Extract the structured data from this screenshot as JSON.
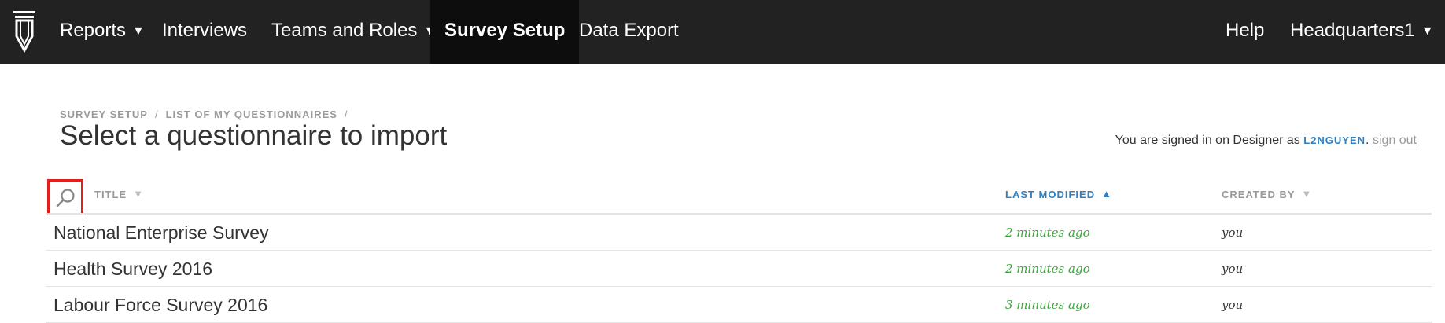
{
  "navbar": {
    "logo_icon": "pen-nib-logo-icon",
    "items": [
      {
        "label": "Reports",
        "dropdown": true
      },
      {
        "label": "Interviews",
        "dropdown": false
      },
      {
        "label": "Teams and Roles",
        "dropdown": true
      },
      {
        "label": "Survey Setup",
        "dropdown": false,
        "active": true
      },
      {
        "label": "Data Export",
        "dropdown": false
      }
    ],
    "right_items": [
      {
        "label": "Help",
        "dropdown": false
      },
      {
        "label": "Headquarters1",
        "dropdown": true
      }
    ],
    "caret": "▼"
  },
  "breadcrumb": {
    "items": [
      "Survey Setup",
      "List of my questionnaires"
    ],
    "separator": "/"
  },
  "page_title": "Select a questionnaire to import",
  "signin": {
    "prefix": "You are signed in on Designer as",
    "username": "L2NGUYEN",
    "punct": ".",
    "sign_out": "sign out"
  },
  "table": {
    "search_icon": "search-icon",
    "columns": {
      "title": "Title",
      "last_modified": "Last Modified",
      "created_by": "Created By"
    },
    "sort": {
      "column": "last_modified",
      "direction": "ascending"
    },
    "sort_icon_up": "▲",
    "sort_icon_down": "▼",
    "rows": [
      {
        "title": "National Enterprise Survey",
        "last_modified": "2 minutes ago",
        "created_by": "you"
      },
      {
        "title": "Health Survey 2016",
        "last_modified": "2 minutes ago",
        "created_by": "you"
      },
      {
        "title": "Labour Force Survey 2016",
        "last_modified": "3 minutes ago",
        "created_by": "you"
      }
    ]
  },
  "colors": {
    "navbar_bg": "#222222",
    "active_tab_bg": "#0d0d0d",
    "link_blue": "#2f7fc1",
    "time_green": "#3aa63a",
    "highlight_red": "#e0201b"
  }
}
